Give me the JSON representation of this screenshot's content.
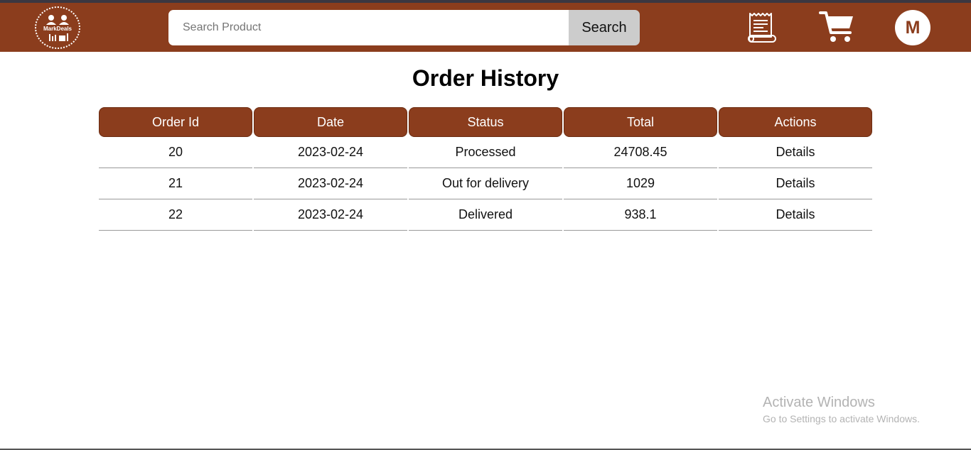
{
  "navbar": {
    "logo_text": "MarkDeals",
    "search": {
      "placeholder": "Search Product",
      "value": "",
      "button_label": "Search"
    },
    "icons": [
      "orders-receipt-icon",
      "cart-icon"
    ],
    "avatar_initial": "M"
  },
  "page": {
    "title": "Order History"
  },
  "table": {
    "headers": [
      "Order Id",
      "Date",
      "Status",
      "Total",
      "Actions"
    ],
    "rows": [
      {
        "id": "20",
        "date": "2023-02-24",
        "status": "Processed",
        "total": "24708.45",
        "action": "Details"
      },
      {
        "id": "21",
        "date": "2023-02-24",
        "status": "Out for delivery",
        "total": "1029",
        "action": "Details"
      },
      {
        "id": "22",
        "date": "2023-02-24",
        "status": "Delivered",
        "total": "938.1",
        "action": "Details"
      }
    ]
  },
  "watermark": {
    "title": "Activate Windows",
    "subtitle": "Go to Settings to activate Windows."
  },
  "colors": {
    "brand": "#8b3d1d",
    "search_button": "#cccccc"
  }
}
